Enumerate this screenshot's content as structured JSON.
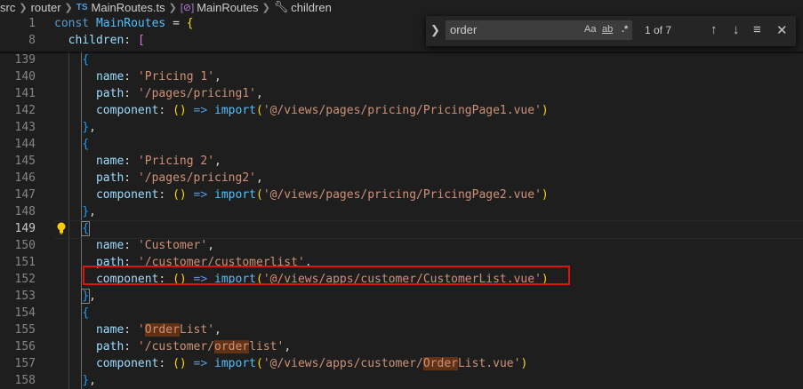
{
  "breadcrumb": {
    "items": [
      "src",
      "router",
      "MainRoutes.ts",
      "MainRoutes",
      "children"
    ],
    "ts_badge": "TS",
    "symbol_badge": "[⊘]"
  },
  "find_widget": {
    "query": "order",
    "match_case": "Aa",
    "whole_word": "ab",
    "regex": ".*",
    "match_count": "1 of 7",
    "prev_icon": "arrow-up-icon",
    "next_icon": "arrow-down-icon",
    "selection_icon": "find-in-selection-icon",
    "close_icon": "close-icon"
  },
  "sticky_lines": [
    {
      "num": "1",
      "parts": [
        [
          "const ",
          "k-blue"
        ],
        [
          "MainRoutes",
          "k-var"
        ],
        [
          " = ",
          "k-punc"
        ],
        [
          "{",
          "k-brk1"
        ]
      ]
    },
    {
      "num": "8",
      "parts": [
        [
          "  children",
          "k-prop"
        ],
        [
          ": ",
          "k-punc"
        ],
        [
          "[",
          "k-brk2"
        ]
      ]
    }
  ],
  "lines": [
    {
      "num": "139",
      "parts": [
        [
          "    ",
          ""
        ],
        [
          "{",
          "k-brk3"
        ]
      ]
    },
    {
      "num": "140",
      "parts": [
        [
          "      name",
          "k-prop"
        ],
        [
          ": ",
          "k-punc"
        ],
        [
          "'Pricing 1'",
          "k-str"
        ],
        [
          ",",
          "k-punc"
        ]
      ]
    },
    {
      "num": "141",
      "parts": [
        [
          "      path",
          "k-prop"
        ],
        [
          ": ",
          "k-punc"
        ],
        [
          "'/pages/pricing1'",
          "k-str"
        ],
        [
          ",",
          "k-punc"
        ]
      ]
    },
    {
      "num": "142",
      "parts": [
        [
          "      component",
          "k-prop"
        ],
        [
          ": ",
          "k-punc"
        ],
        [
          "()",
          "k-brk1"
        ],
        [
          " => ",
          "k-arrow"
        ],
        [
          "import",
          "k-imp"
        ],
        [
          "(",
          "k-brk1"
        ],
        [
          "'@/views/pages/pricing/PricingPage1.vue'",
          "k-str"
        ],
        [
          ")",
          "k-brk1"
        ]
      ]
    },
    {
      "num": "143",
      "parts": [
        [
          "    ",
          ""
        ],
        [
          "}",
          "k-brk3"
        ],
        [
          ",",
          "k-punc"
        ]
      ]
    },
    {
      "num": "144",
      "parts": [
        [
          "    ",
          ""
        ],
        [
          "{",
          "k-brk3"
        ]
      ]
    },
    {
      "num": "145",
      "parts": [
        [
          "      name",
          "k-prop"
        ],
        [
          ": ",
          "k-punc"
        ],
        [
          "'Pricing 2'",
          "k-str"
        ],
        [
          ",",
          "k-punc"
        ]
      ]
    },
    {
      "num": "146",
      "parts": [
        [
          "      path",
          "k-prop"
        ],
        [
          ": ",
          "k-punc"
        ],
        [
          "'/pages/pricing2'",
          "k-str"
        ],
        [
          ",",
          "k-punc"
        ]
      ]
    },
    {
      "num": "147",
      "parts": [
        [
          "      component",
          "k-prop"
        ],
        [
          ": ",
          "k-punc"
        ],
        [
          "()",
          "k-brk1"
        ],
        [
          " => ",
          "k-arrow"
        ],
        [
          "import",
          "k-imp"
        ],
        [
          "(",
          "k-brk1"
        ],
        [
          "'@/views/pages/pricing/PricingPage2.vue'",
          "k-str"
        ],
        [
          ")",
          "k-brk1"
        ]
      ]
    },
    {
      "num": "148",
      "parts": [
        [
          "    ",
          ""
        ],
        [
          "}",
          "k-brk3"
        ],
        [
          ",",
          "k-punc"
        ]
      ]
    },
    {
      "num": "149",
      "active": true,
      "parts": [
        [
          "    ",
          ""
        ],
        [
          "{",
          "k-brk3 bracket-box"
        ]
      ]
    },
    {
      "num": "150",
      "parts": [
        [
          "      name",
          "k-prop"
        ],
        [
          ": ",
          "k-punc"
        ],
        [
          "'Customer'",
          "k-str"
        ],
        [
          ",",
          "k-punc"
        ]
      ]
    },
    {
      "num": "151",
      "parts": [
        [
          "      path",
          "k-prop"
        ],
        [
          ": ",
          "k-punc"
        ],
        [
          "'/customer/customerlist'",
          "k-str"
        ],
        [
          ",",
          "k-punc"
        ]
      ]
    },
    {
      "num": "152",
      "parts": [
        [
          "      component",
          "k-prop"
        ],
        [
          ": ",
          "k-punc"
        ],
        [
          "()",
          "k-brk1"
        ],
        [
          " => ",
          "k-arrow"
        ],
        [
          "import",
          "k-imp"
        ],
        [
          "(",
          "k-brk1"
        ],
        [
          "'@/views/apps/customer/CustomerList.vue'",
          "k-str"
        ],
        [
          ")",
          "k-brk1"
        ]
      ]
    },
    {
      "num": "153",
      "parts": [
        [
          "    ",
          ""
        ],
        [
          "}",
          "k-brk3 bracket-box"
        ],
        [
          ",",
          "k-punc"
        ]
      ]
    },
    {
      "num": "154",
      "parts": [
        [
          "    ",
          ""
        ],
        [
          "{",
          "k-brk3"
        ]
      ]
    },
    {
      "num": "155",
      "parts": [
        [
          "      name",
          "k-prop"
        ],
        [
          ": ",
          "k-punc"
        ],
        [
          "'",
          "k-str"
        ],
        [
          "Order",
          "k-str hl"
        ],
        [
          "List'",
          "k-str"
        ],
        [
          ",",
          "k-punc"
        ]
      ]
    },
    {
      "num": "156",
      "parts": [
        [
          "      path",
          "k-prop"
        ],
        [
          ": ",
          "k-punc"
        ],
        [
          "'/customer/",
          "k-str"
        ],
        [
          "order",
          "k-str hl"
        ],
        [
          "list'",
          "k-str"
        ],
        [
          ",",
          "k-punc"
        ]
      ]
    },
    {
      "num": "157",
      "parts": [
        [
          "      component",
          "k-prop"
        ],
        [
          ": ",
          "k-punc"
        ],
        [
          "()",
          "k-brk1"
        ],
        [
          " => ",
          "k-arrow"
        ],
        [
          "import",
          "k-imp"
        ],
        [
          "(",
          "k-brk1"
        ],
        [
          "'@/views/apps/customer/",
          "k-str"
        ],
        [
          "Order",
          "k-str hl"
        ],
        [
          "List.vue'",
          "k-str"
        ],
        [
          ")",
          "k-brk1"
        ]
      ]
    },
    {
      "num": "158",
      "parts": [
        [
          "    ",
          ""
        ],
        [
          "}",
          "k-brk3"
        ],
        [
          ",",
          "k-punc"
        ]
      ]
    }
  ],
  "colors": {
    "editor_bg": "#1e1e1e",
    "annotation_red": "#e0120f",
    "find_highlight": "#613214"
  }
}
